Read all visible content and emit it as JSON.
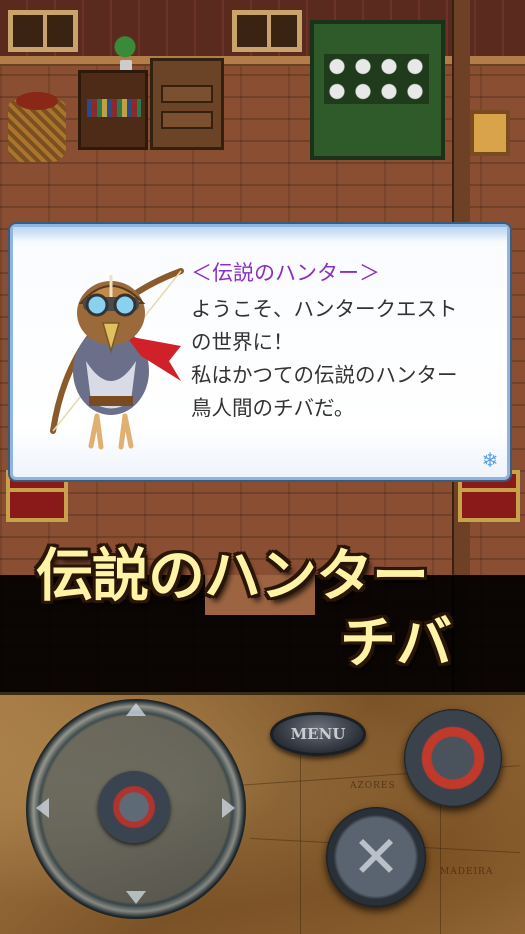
{
  "dialog": {
    "speaker": "＜伝説のハンター＞",
    "lines": [
      "ようこそ、ハンタークエスト",
      "の世界に！",
      "私はかつての伝説のハンター",
      "鳥人間のチバだ。"
    ],
    "advance_icon": "snowflake-icon"
  },
  "caption": {
    "line1": "伝説のハンター",
    "line2": "チバ"
  },
  "controls": {
    "menu_label": "MENU",
    "confirm_icon": "circle-icon",
    "cancel_icon": "cross-icon",
    "cancel_glyph": "✕",
    "dpad_icons": [
      "arrow-up-icon",
      "arrow-down-icon",
      "arrow-left-icon",
      "arrow-right-icon"
    ],
    "map_labels": [
      "AZORES",
      "MADEIRA"
    ]
  },
  "colors": {
    "speaker_name": "#8a2fc4",
    "caption_text": "#fff3a6",
    "dialog_border": "#8fb4de",
    "confirm_ring": "#c0392b"
  }
}
